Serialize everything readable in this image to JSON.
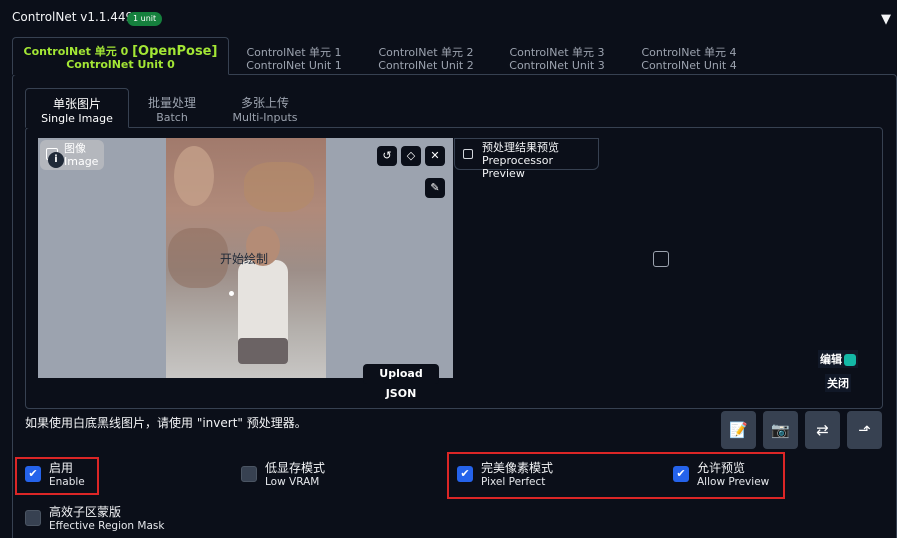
{
  "header": {
    "title": "ControlNet v1.1.449",
    "badge": "1 unit",
    "collapse_glyph": "▼"
  },
  "unit_tabs": [
    {
      "zh": "ControlNet 单元 0",
      "tag": "[OpenPose]",
      "en": "ControlNet Unit 0",
      "active": true
    },
    {
      "zh": "ControlNet 单元 1",
      "en": "ControlNet Unit 1"
    },
    {
      "zh": "ControlNet 单元 2",
      "en": "ControlNet Unit 2"
    },
    {
      "zh": "ControlNet 单元 3",
      "en": "ControlNet Unit 3"
    },
    {
      "zh": "ControlNet 单元 4",
      "en": "ControlNet Unit 4"
    }
  ],
  "image_tabs": [
    {
      "zh": "单张图片",
      "en": "Single Image",
      "active": true
    },
    {
      "zh": "批量处理",
      "en": "Batch"
    },
    {
      "zh": "多张上传",
      "en": "Multi-Inputs"
    }
  ],
  "canvas": {
    "label_zh": "图像",
    "label_en": "Image",
    "info_glyph": "i",
    "start_draw": "开始绘制",
    "upload_json": "Upload JSON",
    "undo_glyph": "↺",
    "erase_glyph": "◇",
    "close_glyph": "✕",
    "brush_glyph": "✎"
  },
  "preprocessor": {
    "label_zh": "预处理结果预览",
    "label_en": "Preprocessor Preview",
    "edit": "编辑",
    "close": "关闭"
  },
  "hint": "如果使用白底黑线图片，请使用 \"invert\" 预处理器。",
  "tools": [
    {
      "icon": "document-edit-icon",
      "glyph": "📝"
    },
    {
      "icon": "camera-icon",
      "glyph": "📷"
    },
    {
      "icon": "swap-icon",
      "glyph": "⇄"
    },
    {
      "icon": "send-dimensions-icon",
      "glyph": "⬏"
    }
  ],
  "options": {
    "enable": {
      "zh": "启用",
      "en": "Enable",
      "checked": true
    },
    "low_vram": {
      "zh": "低显存模式",
      "en": "Low VRAM",
      "checked": false
    },
    "pixel_perfect": {
      "zh": "完美像素模式",
      "en": "Pixel Perfect",
      "checked": true
    },
    "allow_preview": {
      "zh": "允许预览",
      "en": "Allow Preview",
      "checked": true
    },
    "region_mask": {
      "zh": "高效子区蒙版",
      "en": "Effective Region Mask",
      "checked": false
    },
    "check_glyph": "✔"
  },
  "colors": {
    "accent": "#a3e635",
    "checkbox": "#2563eb",
    "highlight": "#dc2626",
    "badge": "#15803d"
  }
}
